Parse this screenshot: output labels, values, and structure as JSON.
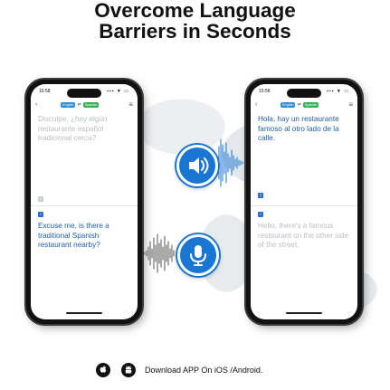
{
  "headline": {
    "line1": "Overcome Language",
    "line2": "Barriers in Seconds"
  },
  "phone_left": {
    "time": "15:58",
    "signal": "▪▪▪ ▼ ▭",
    "lang_from": "English",
    "lang_to": "Spanish",
    "source_text": "Disculpe, ¿hay algún restaurante español tradicional cerca?",
    "translated_text": "Excuse me, is there a traditional Spanish restaurant nearby?"
  },
  "phone_right": {
    "time": "15:58",
    "signal": "▪▪▪ ▼ ▭",
    "lang_from": "English",
    "lang_to": "Spanish",
    "translated_text": "Hola, hay un restaurante famoso al otro lado de la calle.",
    "source_text": "Hello, there's a famous restaurant on the other side of the street."
  },
  "icons": {
    "speaker": "speaker-icon",
    "mic": "microphone-icon",
    "apple": "apple-icon",
    "android": "android-icon"
  },
  "colors": {
    "accent": "#1976d2",
    "text_blue": "#1d5fa8",
    "muted": "#b9bec4"
  },
  "footer": {
    "download_text": "Download APP On iOS /Android."
  }
}
